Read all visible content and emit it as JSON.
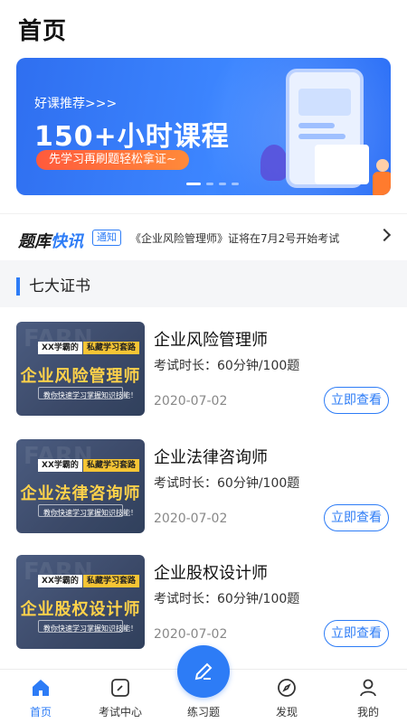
{
  "header": {
    "title": "首页"
  },
  "banner": {
    "subtitle": "好课推荐>>>",
    "headline": "150+小时课程",
    "pill": "先学习再刷题轻松拿证~"
  },
  "news": {
    "brand_a": "题库",
    "brand_b": "快讯",
    "tag": "通知",
    "text": "《企业风险管理师》证将在7月2号开始考试"
  },
  "section": {
    "title": "七大证书"
  },
  "courses": [
    {
      "name": "企业风险管理师",
      "meta": "考试时长：60分钟/100题",
      "date": "2020-07-02",
      "action": "立即查看",
      "thumb": {
        "tag_a": "XX学霸的",
        "tag_b": "私藏学习套路",
        "title": "企业风险管理师",
        "caption": "教你快速学习掌握知识技能！"
      }
    },
    {
      "name": "企业法律咨询师",
      "meta": "考试时长：60分钟/100题",
      "date": "2020-07-02",
      "action": "立即查看",
      "thumb": {
        "tag_a": "XX学霸的",
        "tag_b": "私藏学习套路",
        "title": "企业法律咨询师",
        "caption": "教你快速学习掌握知识技能！"
      }
    },
    {
      "name": "企业股权设计师",
      "meta": "考试时长：60分钟/100题",
      "date": "2020-07-02",
      "action": "立即查看",
      "thumb": {
        "tag_a": "XX学霸的",
        "tag_b": "私藏学习套路",
        "title": "企业股权设计师",
        "caption": "教你快速学习掌握知识技能！"
      }
    }
  ],
  "nav": {
    "items": [
      {
        "label": "首页",
        "icon": "home-icon"
      },
      {
        "label": "考试中心",
        "icon": "exam-icon"
      },
      {
        "label": "练习题",
        "icon": "pen-icon"
      },
      {
        "label": "发现",
        "icon": "compass-icon"
      },
      {
        "label": "我的",
        "icon": "user-icon"
      }
    ]
  },
  "colors": {
    "accent": "#2d7cf6",
    "cta": "#ff6a3a"
  }
}
